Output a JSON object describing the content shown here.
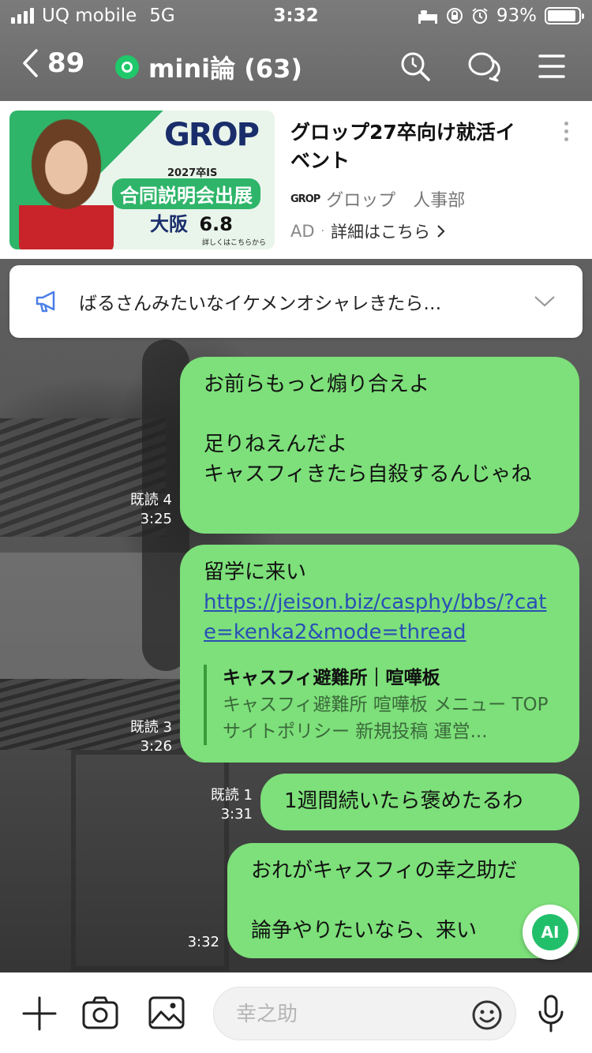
{
  "status": {
    "carrier": "UQ mobile",
    "network": "5G",
    "time": "3:32",
    "battery": "93%",
    "battery_level": 0.93
  },
  "header": {
    "back_count": "89",
    "chat_title": "mini論 (63)",
    "icons": [
      "back-icon",
      "search-icon",
      "chat-bubbles-icon",
      "menu-icon"
    ]
  },
  "ad": {
    "title": "グロップ27卒向け就活イベント",
    "brand_logo": "GROP",
    "brand": "グロップ　人事部",
    "label": "AD",
    "link": "詳細はこちら",
    "image": {
      "logo": "GROP",
      "year": "2027卒IS",
      "event": "合同説明会出展",
      "city": "大阪",
      "date": "6.8",
      "note": "詳しくはこちらから"
    }
  },
  "announcement": {
    "text": "ばるさんみたいなイケメンオシャレきたら…"
  },
  "messages": [
    {
      "read": "既読 4",
      "time": "3:25",
      "lines": [
        "お前らもっと煽り合えよ",
        "",
        "足りねえんだよ",
        "キャスフィきたら自殺するんじゃね"
      ]
    },
    {
      "read": "既読 3",
      "time": "3:26",
      "text": "留学に来い",
      "link": "https://jeison.biz/casphy/bbs/?cate=kenka2&mode=thread",
      "preview_title": "キャスフィ避難所｜喧嘩板",
      "preview_desc": "キャスフィ避難所 喧嘩板 メニュー TOP サイトポリシー 新規投稿 運営..."
    },
    {
      "read": "既読 1",
      "time": "3:31",
      "text": "1週間続いたら褒めたるわ"
    },
    {
      "read": "",
      "time": "3:32",
      "lines": [
        "おれがキャスフィの幸之助だ",
        "",
        "論争やりたいなら、来い"
      ]
    }
  ],
  "ai_button": "AI",
  "composer": {
    "placeholder": "幸之助",
    "icons": [
      "plus-icon",
      "camera-icon",
      "image-icon",
      "emoji-icon",
      "microphone-icon"
    ]
  },
  "colors": {
    "bubble": "#7de07a",
    "accent_green": "#22bf6b",
    "link": "#2a4fb5"
  }
}
